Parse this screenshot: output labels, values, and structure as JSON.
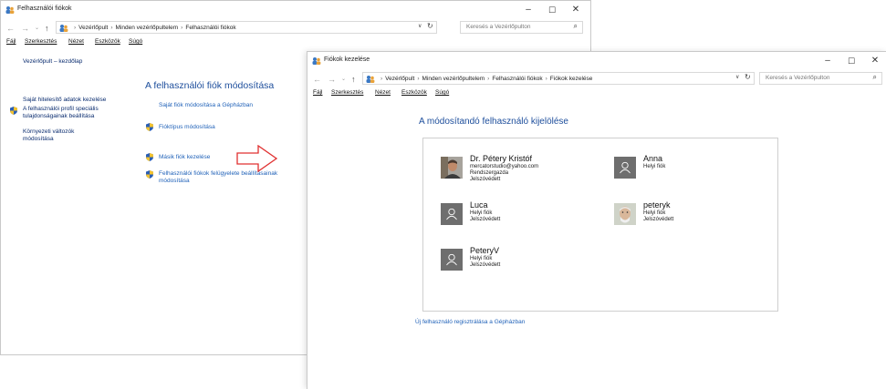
{
  "window1": {
    "title": "Felhasználói fiókok",
    "breadcrumbs": [
      "Vezérlőpult",
      "Minden vezérlőpultelem",
      "Felhasználói fiókok"
    ],
    "search_placeholder": "Keresés a Vezérlőpulton",
    "menu": [
      "Fájl",
      "Szerkesztés",
      "Nézet",
      "Eszközök",
      "Súgó"
    ],
    "sidebar": {
      "home": "Vezérlőpult – kezdőlap",
      "credentials": "Saját hitelesítő adatok kezelése",
      "profile_line1": "A felhasználói profil speciális",
      "profile_line2": "tulajdonságainak beállítása",
      "env_line1": "Környezeti változók",
      "env_line2": "módosítása"
    },
    "main": {
      "heading": "A felhasználói fiók módosítása",
      "pcsettings": "Saját fiók módosítása a Gépházban",
      "acct_type": "Fióktípus módosítása",
      "manage_other": "Másik fiók kezelése",
      "uac_line1": "Felhasználói fiókok felügyelete beállításainak",
      "uac_line2": "módosítása"
    }
  },
  "window2": {
    "title": "Fiókok kezelése",
    "breadcrumbs": [
      "Vezérlőpult",
      "Minden vezérlőpultelem",
      "Felhasználói fiókok",
      "Fiókok kezelése"
    ],
    "search_placeholder": "Keresés a Vezérlőpulton",
    "menu": [
      "Fájl",
      "Szerkesztés",
      "Nézet",
      "Eszközök",
      "Súgó"
    ],
    "heading": "A módosítandó felhasználó kijelölése",
    "accounts": [
      {
        "name": "Dr. Pétery Kristóf",
        "line1": "mercatorstudio@yahoo.com",
        "line2": "Rendszergazda",
        "line3": "Jelszóvédett"
      },
      {
        "name": "Anna",
        "line1": "Helyi fiók"
      },
      {
        "name": "Luca",
        "line1": "Helyi fiók",
        "line2": "Jelszóvédett"
      },
      {
        "name": "peteryk",
        "line1": "Helyi fiók",
        "line2": "Jelszóvédett"
      },
      {
        "name": "PeteryV",
        "line1": "Helyi fiók",
        "line2": "Jelszóvédett"
      }
    ],
    "add_user_link": "Új felhasználó regisztrálása a Gépházban"
  },
  "colors": {
    "link": "#1f61b8",
    "heading": "#1d4e9c",
    "avatar_bg": "#6e6e6e",
    "arrow": "#e03030"
  }
}
